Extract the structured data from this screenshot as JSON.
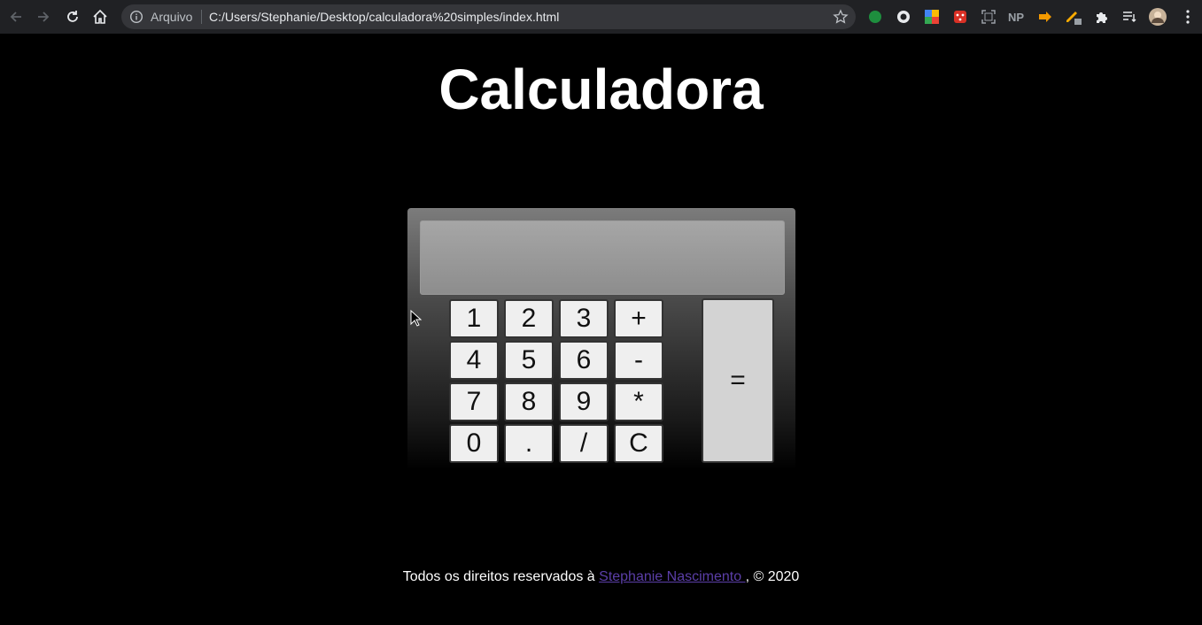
{
  "browser": {
    "omnibox_label": "Arquivo",
    "url": "C:/Users/Stephanie/Desktop/calculadora%20simples/index.html"
  },
  "page": {
    "title": "Calculadora"
  },
  "calculator": {
    "display_value": "",
    "keys": [
      "1",
      "2",
      "3",
      "+",
      "4",
      "5",
      "6",
      "-",
      "7",
      "8",
      "9",
      "*",
      "0",
      ".",
      "/",
      "C"
    ],
    "equals": "="
  },
  "footer": {
    "prefix": "Todos os direitos reservados à ",
    "author_link": "Stephanie Nascimento ",
    "suffix": ", © 2020"
  },
  "colors": {
    "background": "#000000",
    "link": "#5b3ea8",
    "key_bg": "#efefef",
    "equals_bg": "#d3d3d3"
  }
}
